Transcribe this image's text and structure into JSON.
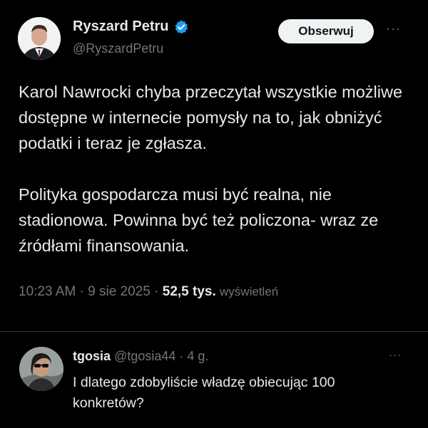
{
  "tweet": {
    "author_name": "Ryszard Petru",
    "author_handle": "@RyszardPetru",
    "follow_label": "Obserwuj",
    "more_label": "···",
    "paragraph_1": "Karol Nawrocki chyba przeczytał wszystkie możliwe dostępne w internecie pomysły na to, jak obniżyć podatki i teraz je zgłasza.",
    "paragraph_2": "Polityka gospodarcza musi być realna, nie stadionowa. Powinna być też policzona- wraz ze źródłami finansowania.",
    "time": "10:23 AM",
    "date": "9 sie 2025",
    "views_count": "52,5 tys.",
    "views_label": "wyświetleń",
    "separator": " · ",
    "verified_icon": "verified-badge-icon",
    "accent_color": "#1d9bf0"
  },
  "reply": {
    "author_name": "tgosia",
    "author_handle": "@tgosia44",
    "separator": "·",
    "time_ago": "4 g.",
    "more_label": "···",
    "text": "I dlatego zdobyliście władzę obiecując 100 konkretów?"
  }
}
